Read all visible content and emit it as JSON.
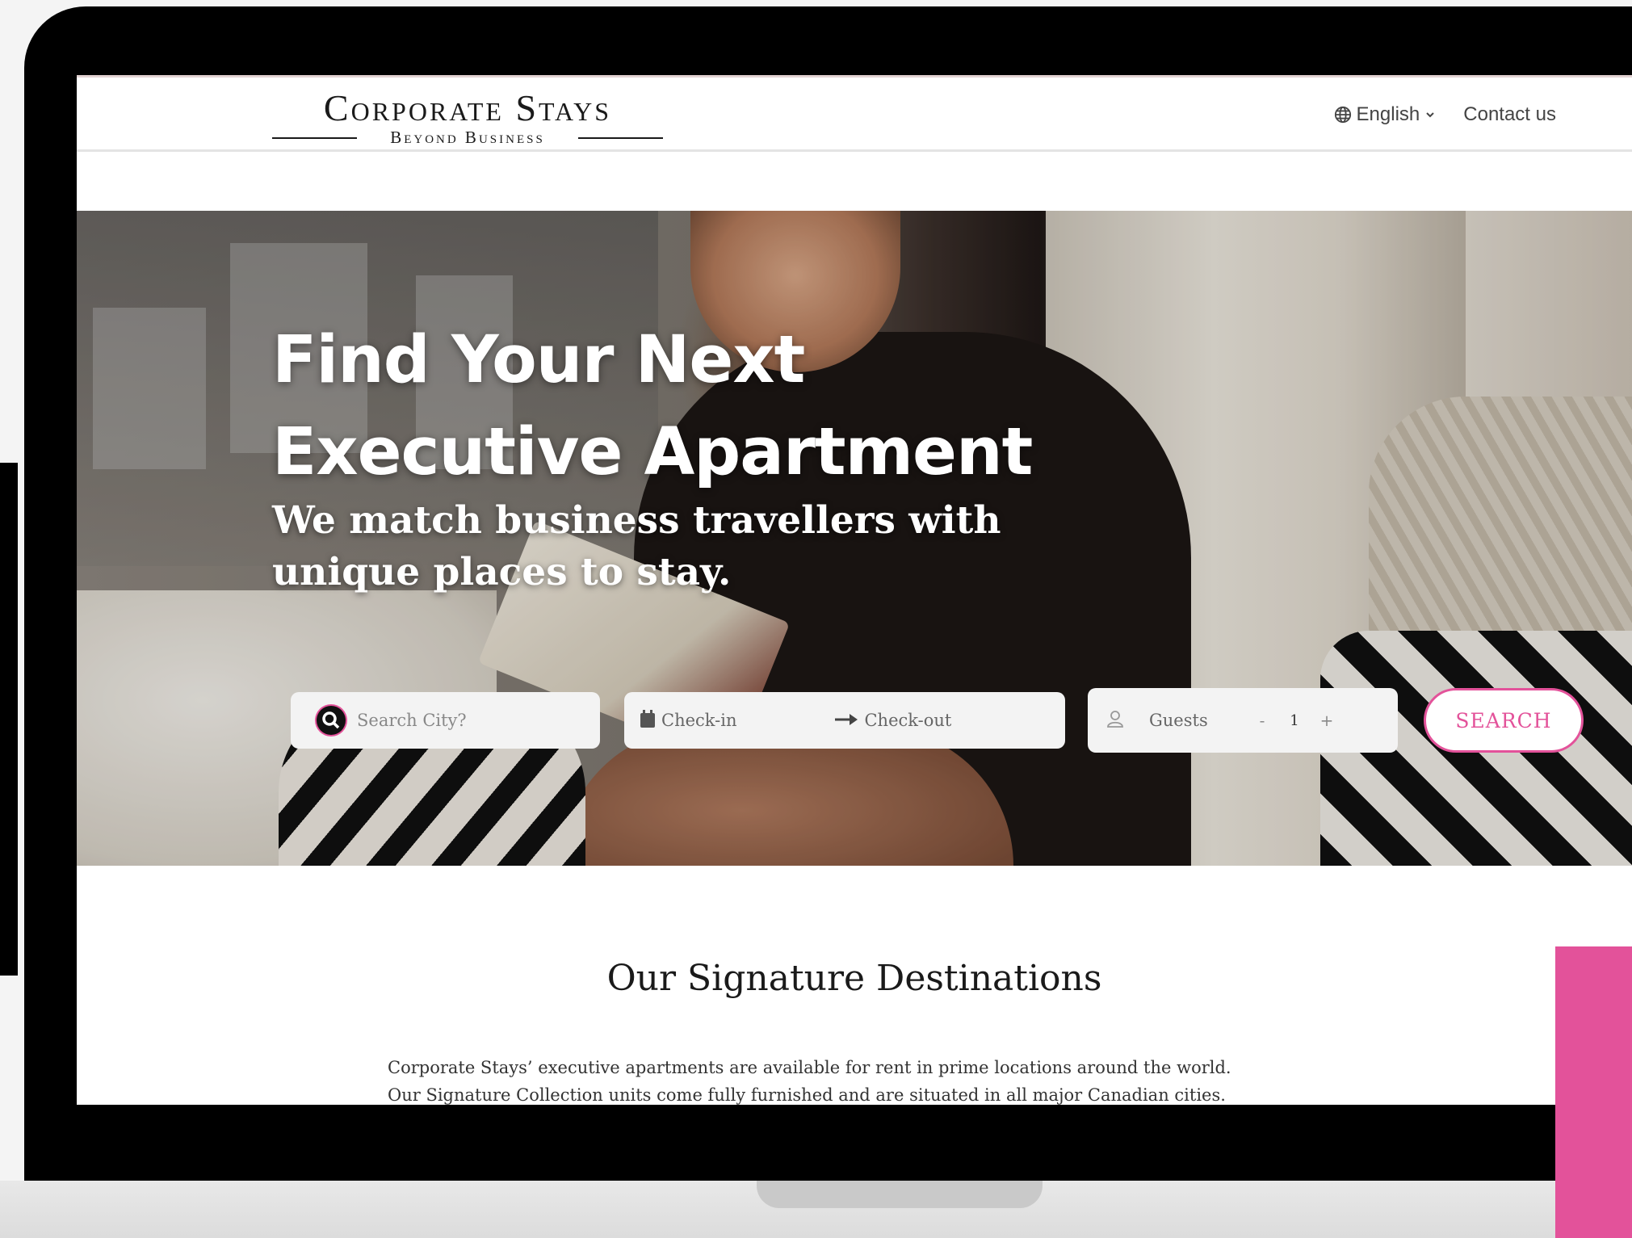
{
  "header": {
    "logo_main": "Corporate Stays",
    "logo_sub": "Beyond Business",
    "language": "English",
    "contact": "Contact us"
  },
  "hero": {
    "title_line1": "Find Your Next",
    "title_line2": "Executive Apartment",
    "subtitle": "We match business travellers with unique places to stay."
  },
  "search": {
    "city_placeholder": "Search City?",
    "checkin": "Check-in",
    "checkout": "Check-out",
    "guests_label": "Guests",
    "minus": "-",
    "guest_count": "1",
    "plus": "+",
    "button": "SEARCH"
  },
  "destinations": {
    "title": "Our Signature Destinations",
    "text_line1": "Corporate Stays’ executive apartments are available for rent in prime locations around the world.",
    "text_line2": "Our Signature Collection units come fully furnished and are situated in all major Canadian cities."
  },
  "colors": {
    "accent": "#e3529a",
    "text_dark": "#1a1a1a",
    "field_bg": "#f3f3f3"
  },
  "icons": [
    "globe-icon",
    "chevron-down-icon",
    "search-icon",
    "calendar-icon",
    "arrow-right-icon",
    "user-icon"
  ]
}
